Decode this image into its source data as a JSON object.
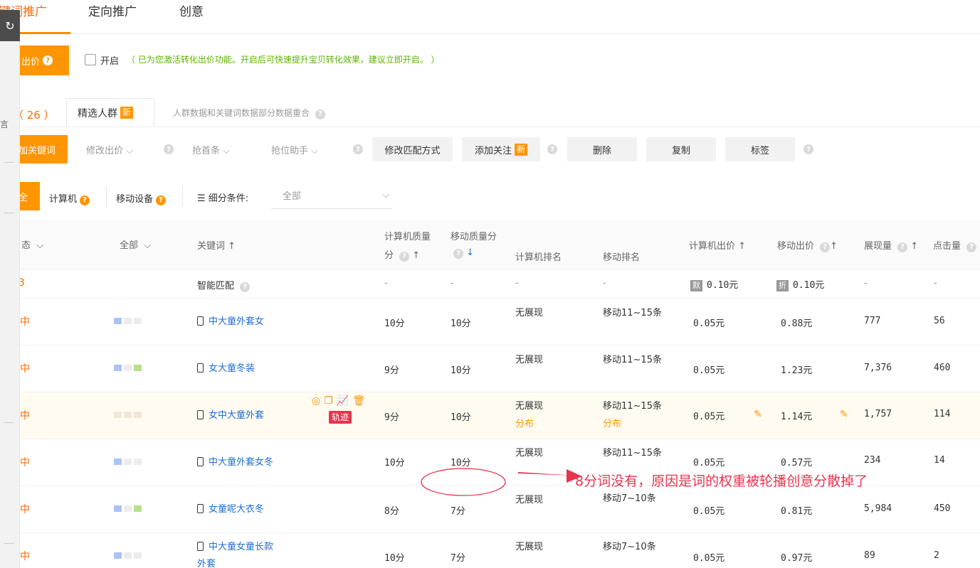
{
  "top_tabs": [
    "键词推广",
    "定向推广",
    "创意"
  ],
  "rail": {
    "top_glyph": "↻",
    "side_glyph": "言"
  },
  "conversion": {
    "button_label": "出价",
    "check_label": "开启",
    "tip": "（ 已为您激活转化出价功能。开启后可快速提升宝贝转化效果，建议立即开启。 ）"
  },
  "keyword_count": "（ 26 ）",
  "audience": {
    "tab_label": "精选人群",
    "new_badge": "新",
    "tip": "人群数据和关键词数据部分数据重合"
  },
  "toolbar": {
    "add_keyword": "加关键词",
    "modify_bid": "修改出价",
    "grab_first": "抢首条",
    "position_helper": "抢位助手",
    "modify_match": "修改匹配方式",
    "add_follow": "添加关注",
    "new_badge": "新",
    "delete": "删除",
    "copy": "复制",
    "tag": "标签"
  },
  "device_tabs": {
    "all": "全",
    "computer": "计算机",
    "mobile": "移动设备",
    "filter_label": "细分条件:",
    "filter_value": "全部"
  },
  "table": {
    "headers": {
      "status": "态",
      "all": "全部",
      "keyword": "关键词",
      "pc_quality_1": "计算机质量",
      "pc_quality_2": "分",
      "mobile_quality_1": "移动质量分",
      "pc_rank": "计算机排名",
      "mobile_rank": "移动排名",
      "pc_bid": "计算机出价",
      "mobile_bid": "移动出价",
      "impressions": "展现量",
      "clicks": "点击量"
    },
    "smart_match": {
      "status": "3",
      "label": "智能匹配",
      "pc_quality": "-",
      "mobile_quality": "-",
      "pc_rank": "-",
      "mobile_rank": "-",
      "pc_badge": "默",
      "pc_bid": "0.10元",
      "mobile_badge": "折",
      "mobile_bid": "0.10元",
      "impressions": "-",
      "clicks": "-"
    },
    "rows": [
      {
        "status": "中",
        "keyword": "中大童外套女",
        "pc_quality": "10分",
        "mobile_quality": "10分",
        "pc_rank": "无展现",
        "mobile_rank": "移动11~15条",
        "pc_bid": "0.05元",
        "mobile_bid": "0.88元",
        "impressions": "777",
        "clicks": "56"
      },
      {
        "status": "中",
        "keyword": "女大童冬装",
        "pc_quality": "9分",
        "mobile_quality": "10分",
        "pc_rank": "无展现",
        "mobile_rank": "移动11~15条",
        "pc_bid": "0.05元",
        "mobile_bid": "1.23元",
        "impressions": "7,376",
        "clicks": "460"
      },
      {
        "status": "中",
        "keyword": "女中大童外套",
        "pc_quality": "9分",
        "mobile_quality": "10分",
        "pc_rank": "无展现",
        "pc_rank_sub": "分布",
        "mobile_rank": "移动11~15条",
        "mobile_rank_sub": "分布",
        "pc_bid": "0.05元",
        "mobile_bid": "1.14元",
        "impressions": "1,757",
        "clicks": "114",
        "track_badge": "轨迹"
      },
      {
        "status": "中",
        "keyword": "中大童外套女冬",
        "pc_quality": "10分",
        "mobile_quality": "10分",
        "pc_rank": "无展现",
        "mobile_rank": "移动11~15条",
        "pc_bid": "0.05元",
        "mobile_bid": "0.57元",
        "impressions": "234",
        "clicks": "14"
      },
      {
        "status": "中",
        "keyword": "女童呢大衣冬",
        "pc_quality": "8分",
        "mobile_quality": "7分",
        "pc_rank": "无展现",
        "mobile_rank": "移动7~10条",
        "pc_bid": "0.05元",
        "mobile_bid": "0.81元",
        "impressions": "5,984",
        "clicks": "450"
      },
      {
        "status": "中",
        "keyword": "中大童女童长款",
        "keyword_line2": "外套",
        "pc_quality": "10分",
        "mobile_quality": "7分",
        "pc_rank": "无展现",
        "mobile_rank": "移动7~10条",
        "pc_bid": "0.05元",
        "mobile_bid": "0.97元",
        "impressions": "89",
        "clicks": "2"
      }
    ]
  },
  "annotation": "8分词没有，原因是词的权重被轮播创意分散掉了",
  "colors": {
    "accent": "#ff9500",
    "link": "#1f6ed4",
    "annotation": "#e8344d",
    "tip_green": "#5cb300"
  }
}
